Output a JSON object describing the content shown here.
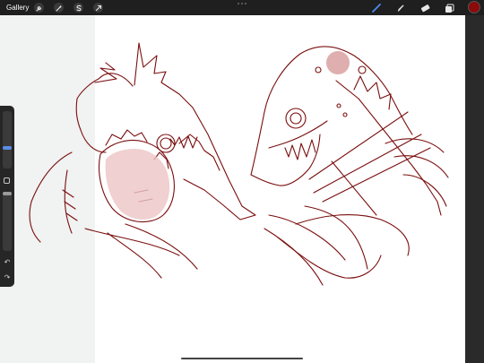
{
  "topbar": {
    "gallery_label": "Gallery",
    "left_tools": [
      {
        "name": "actions",
        "icon": "wrench-icon"
      },
      {
        "name": "adjustments",
        "icon": "magic-wand-icon"
      },
      {
        "name": "selection",
        "icon": "selection-s-icon"
      },
      {
        "name": "transform",
        "icon": "arrow-cursor-icon"
      }
    ],
    "right_tools": [
      {
        "name": "brush",
        "icon": "brush-icon",
        "active": true
      },
      {
        "name": "smudge",
        "icon": "smudge-icon"
      },
      {
        "name": "eraser",
        "icon": "eraser-icon"
      },
      {
        "name": "layers",
        "icon": "layers-icon"
      }
    ],
    "active_color": "#8b0a0a",
    "active_tool_color": "#4d8cf0"
  },
  "sidebar": {
    "brush_size_level": 0.35,
    "opacity_level": 1.0
  },
  "canvas": {
    "background": "#ffffff",
    "stroke_color": "#7a0e0e",
    "fill_color": "#ecc4c4"
  }
}
